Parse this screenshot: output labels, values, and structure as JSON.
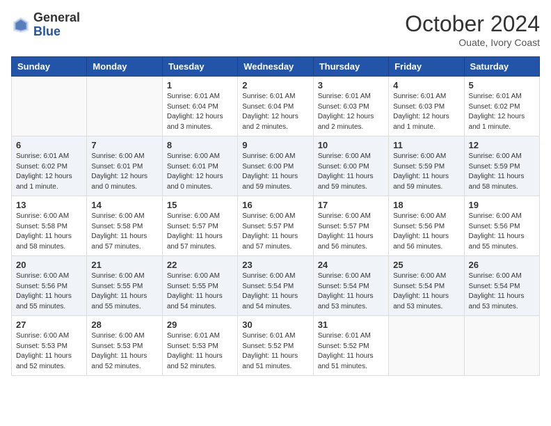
{
  "header": {
    "logo_line1": "General",
    "logo_line2": "Blue",
    "month": "October 2024",
    "location": "Ouate, Ivory Coast"
  },
  "weekdays": [
    "Sunday",
    "Monday",
    "Tuesday",
    "Wednesday",
    "Thursday",
    "Friday",
    "Saturday"
  ],
  "weeks": [
    {
      "alt": false,
      "days": [
        {
          "num": "",
          "empty": true
        },
        {
          "num": "",
          "empty": true
        },
        {
          "num": "1",
          "info": "Sunrise: 6:01 AM\nSunset: 6:04 PM\nDaylight: 12 hours\nand 3 minutes."
        },
        {
          "num": "2",
          "info": "Sunrise: 6:01 AM\nSunset: 6:04 PM\nDaylight: 12 hours\nand 2 minutes."
        },
        {
          "num": "3",
          "info": "Sunrise: 6:01 AM\nSunset: 6:03 PM\nDaylight: 12 hours\nand 2 minutes."
        },
        {
          "num": "4",
          "info": "Sunrise: 6:01 AM\nSunset: 6:03 PM\nDaylight: 12 hours\nand 1 minute."
        },
        {
          "num": "5",
          "info": "Sunrise: 6:01 AM\nSunset: 6:02 PM\nDaylight: 12 hours\nand 1 minute."
        }
      ]
    },
    {
      "alt": true,
      "days": [
        {
          "num": "6",
          "info": "Sunrise: 6:01 AM\nSunset: 6:02 PM\nDaylight: 12 hours\nand 1 minute."
        },
        {
          "num": "7",
          "info": "Sunrise: 6:00 AM\nSunset: 6:01 PM\nDaylight: 12 hours\nand 0 minutes."
        },
        {
          "num": "8",
          "info": "Sunrise: 6:00 AM\nSunset: 6:01 PM\nDaylight: 12 hours\nand 0 minutes."
        },
        {
          "num": "9",
          "info": "Sunrise: 6:00 AM\nSunset: 6:00 PM\nDaylight: 11 hours\nand 59 minutes."
        },
        {
          "num": "10",
          "info": "Sunrise: 6:00 AM\nSunset: 6:00 PM\nDaylight: 11 hours\nand 59 minutes."
        },
        {
          "num": "11",
          "info": "Sunrise: 6:00 AM\nSunset: 5:59 PM\nDaylight: 11 hours\nand 59 minutes."
        },
        {
          "num": "12",
          "info": "Sunrise: 6:00 AM\nSunset: 5:59 PM\nDaylight: 11 hours\nand 58 minutes."
        }
      ]
    },
    {
      "alt": false,
      "days": [
        {
          "num": "13",
          "info": "Sunrise: 6:00 AM\nSunset: 5:58 PM\nDaylight: 11 hours\nand 58 minutes."
        },
        {
          "num": "14",
          "info": "Sunrise: 6:00 AM\nSunset: 5:58 PM\nDaylight: 11 hours\nand 57 minutes."
        },
        {
          "num": "15",
          "info": "Sunrise: 6:00 AM\nSunset: 5:57 PM\nDaylight: 11 hours\nand 57 minutes."
        },
        {
          "num": "16",
          "info": "Sunrise: 6:00 AM\nSunset: 5:57 PM\nDaylight: 11 hours\nand 57 minutes."
        },
        {
          "num": "17",
          "info": "Sunrise: 6:00 AM\nSunset: 5:57 PM\nDaylight: 11 hours\nand 56 minutes."
        },
        {
          "num": "18",
          "info": "Sunrise: 6:00 AM\nSunset: 5:56 PM\nDaylight: 11 hours\nand 56 minutes."
        },
        {
          "num": "19",
          "info": "Sunrise: 6:00 AM\nSunset: 5:56 PM\nDaylight: 11 hours\nand 55 minutes."
        }
      ]
    },
    {
      "alt": true,
      "days": [
        {
          "num": "20",
          "info": "Sunrise: 6:00 AM\nSunset: 5:56 PM\nDaylight: 11 hours\nand 55 minutes."
        },
        {
          "num": "21",
          "info": "Sunrise: 6:00 AM\nSunset: 5:55 PM\nDaylight: 11 hours\nand 55 minutes."
        },
        {
          "num": "22",
          "info": "Sunrise: 6:00 AM\nSunset: 5:55 PM\nDaylight: 11 hours\nand 54 minutes."
        },
        {
          "num": "23",
          "info": "Sunrise: 6:00 AM\nSunset: 5:54 PM\nDaylight: 11 hours\nand 54 minutes."
        },
        {
          "num": "24",
          "info": "Sunrise: 6:00 AM\nSunset: 5:54 PM\nDaylight: 11 hours\nand 53 minutes."
        },
        {
          "num": "25",
          "info": "Sunrise: 6:00 AM\nSunset: 5:54 PM\nDaylight: 11 hours\nand 53 minutes."
        },
        {
          "num": "26",
          "info": "Sunrise: 6:00 AM\nSunset: 5:54 PM\nDaylight: 11 hours\nand 53 minutes."
        }
      ]
    },
    {
      "alt": false,
      "days": [
        {
          "num": "27",
          "info": "Sunrise: 6:00 AM\nSunset: 5:53 PM\nDaylight: 11 hours\nand 52 minutes."
        },
        {
          "num": "28",
          "info": "Sunrise: 6:00 AM\nSunset: 5:53 PM\nDaylight: 11 hours\nand 52 minutes."
        },
        {
          "num": "29",
          "info": "Sunrise: 6:01 AM\nSunset: 5:53 PM\nDaylight: 11 hours\nand 52 minutes."
        },
        {
          "num": "30",
          "info": "Sunrise: 6:01 AM\nSunset: 5:52 PM\nDaylight: 11 hours\nand 51 minutes."
        },
        {
          "num": "31",
          "info": "Sunrise: 6:01 AM\nSunset: 5:52 PM\nDaylight: 11 hours\nand 51 minutes."
        },
        {
          "num": "",
          "empty": true
        },
        {
          "num": "",
          "empty": true
        }
      ]
    }
  ]
}
